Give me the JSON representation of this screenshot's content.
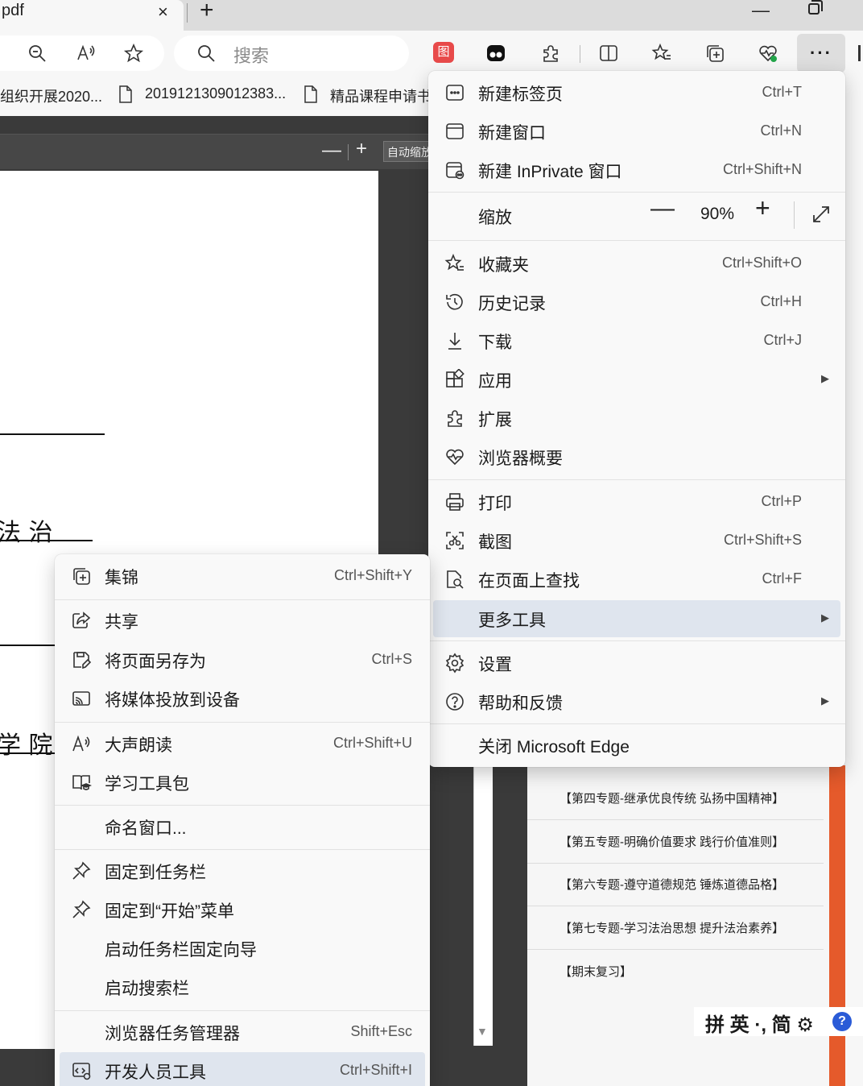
{
  "tab": {
    "title": "pdf",
    "close": "×",
    "new_tab": "+"
  },
  "window": {
    "minimize": "—"
  },
  "toolbar": {
    "search_placeholder": "搜索",
    "ext_label": "图",
    "more_label": "···"
  },
  "favorites": [
    {
      "label": "组织开展2020..."
    },
    {
      "label": "2019121309012383..."
    },
    {
      "label": "精品课程申请书"
    }
  ],
  "pdf": {
    "zoom_minus": "—",
    "zoom_plus": "+",
    "zoom_select": "自动缩放",
    "text1": "法 治",
    "text2": "学 院"
  },
  "main_menu": {
    "new_tab": {
      "label": "新建标签页",
      "shortcut": "Ctrl+T"
    },
    "new_window": {
      "label": "新建窗口",
      "shortcut": "Ctrl+N"
    },
    "new_inprivate": {
      "label": "新建 InPrivate 窗口",
      "shortcut": "Ctrl+Shift+N"
    },
    "zoom": {
      "label": "缩放",
      "value": "90%",
      "minus": "—",
      "plus": "+"
    },
    "favorites": {
      "label": "收藏夹",
      "shortcut": "Ctrl+Shift+O"
    },
    "history": {
      "label": "历史记录",
      "shortcut": "Ctrl+H"
    },
    "downloads": {
      "label": "下载",
      "shortcut": "Ctrl+J"
    },
    "apps": {
      "label": "应用"
    },
    "extensions": {
      "label": "扩展"
    },
    "browser_essentials": {
      "label": "浏览器概要"
    },
    "print": {
      "label": "打印",
      "shortcut": "Ctrl+P"
    },
    "screenshot": {
      "label": "截图",
      "shortcut": "Ctrl+Shift+S"
    },
    "find": {
      "label": "在页面上查找",
      "shortcut": "Ctrl+F"
    },
    "more_tools": {
      "label": "更多工具"
    },
    "settings": {
      "label": "设置"
    },
    "help": {
      "label": "帮助和反馈"
    },
    "close": {
      "label": "关闭 Microsoft Edge"
    }
  },
  "sub_menu": {
    "collections": {
      "label": "集锦",
      "shortcut": "Ctrl+Shift+Y"
    },
    "share": {
      "label": "共享"
    },
    "save_page": {
      "label": "将页面另存为",
      "shortcut": "Ctrl+S"
    },
    "cast": {
      "label": "将媒体投放到设备"
    },
    "read_aloud": {
      "label": "大声朗读",
      "shortcut": "Ctrl+Shift+U"
    },
    "learning": {
      "label": "学习工具包"
    },
    "name_window": {
      "label": "命名窗口..."
    },
    "pin_taskbar": {
      "label": "固定到任务栏"
    },
    "pin_start": {
      "label": "固定到“开始”菜单"
    },
    "taskbar_wizard": {
      "label": "启动任务栏固定向导"
    },
    "search_bar": {
      "label": "启动搜索栏"
    },
    "task_manager": {
      "label": "浏览器任务管理器",
      "shortcut": "Shift+Esc"
    },
    "dev_tools": {
      "label": "开发人员工具",
      "shortcut": "Ctrl+Shift+I"
    }
  },
  "side_list": [
    "【第四专题-继承优良传统 弘扬中国精神】",
    "【第五专题-明确价值要求 践行价值准则】",
    "【第六专题-遵守道德规范 锤炼道德品格】",
    "【第七专题-学习法治思想 提升法治素养】",
    "【期末复习】"
  ],
  "ime": {
    "text": "拼 英 ·, 简 ⚙",
    "help": "?"
  }
}
